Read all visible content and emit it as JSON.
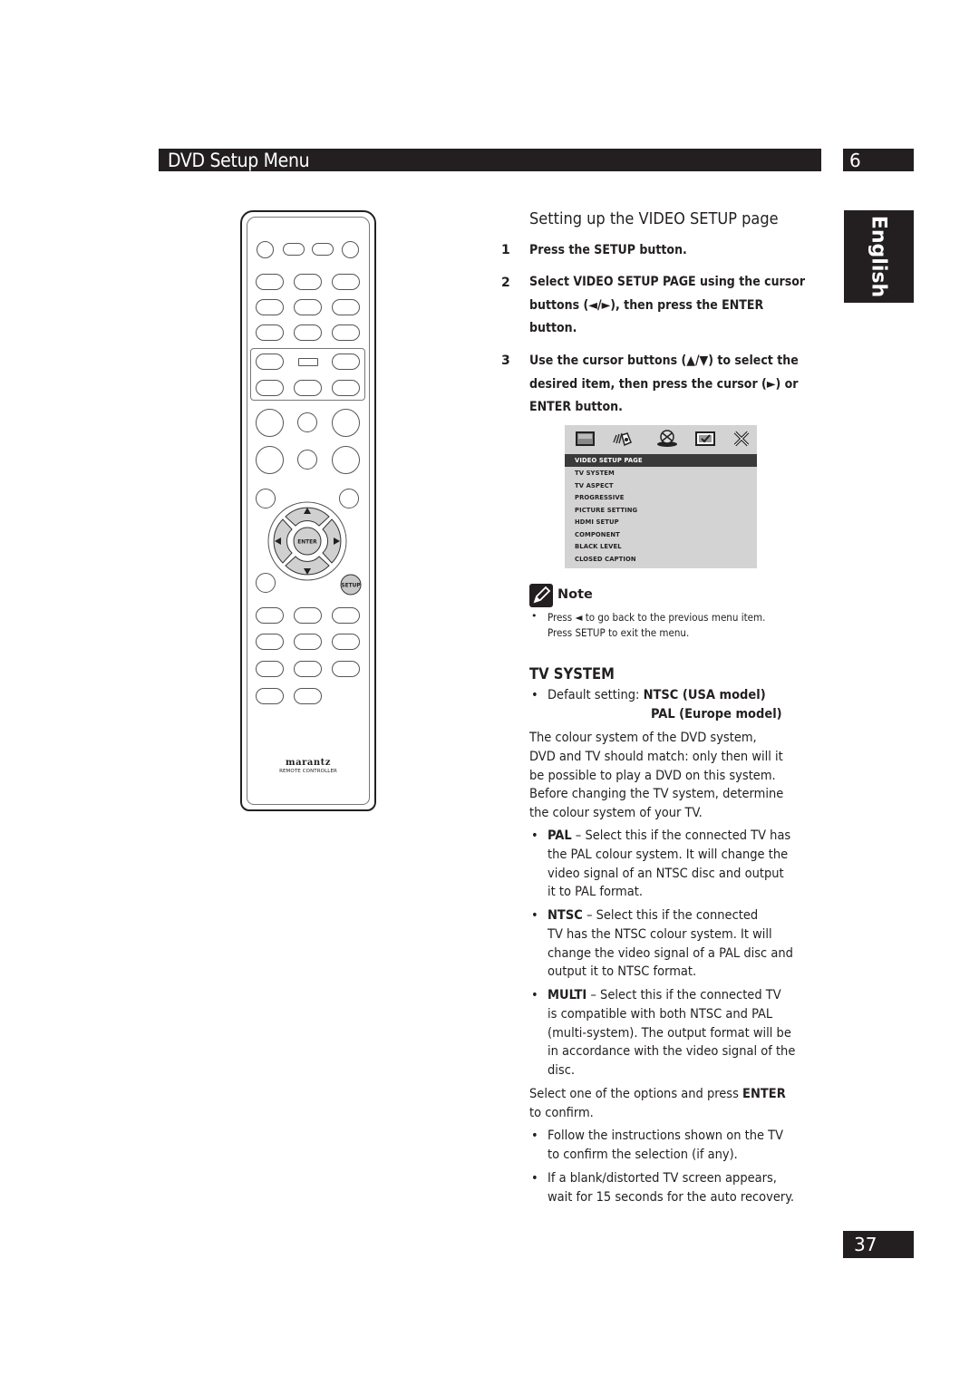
{
  "header": {
    "title": "DVD Setup Menu",
    "chapter": "6"
  },
  "language_tab": "English",
  "remote": {
    "brand": "marantz",
    "subtitle": "REMOTE CONTROLLER",
    "enter_label": "ENTER",
    "setup_label": "SETUP",
    "arrows": {
      "up": "▲",
      "down": "▼",
      "left": "◄",
      "right": "►"
    }
  },
  "section": {
    "title": "Setting up the VIDEO SETUP page",
    "steps": [
      {
        "num": "1",
        "lines": [
          "Press the SETUP button."
        ]
      },
      {
        "num": "2",
        "lines": [
          "Select VIDEO SETUP PAGE using the cursor",
          "buttons (◄/►), then press the ENTER",
          "button."
        ]
      },
      {
        "num": "3",
        "lines": [
          "Use the cursor buttons (▲/▼) to select the",
          "desired item, then press the cursor (►) or",
          "ENTER button."
        ]
      }
    ]
  },
  "osd_menu": {
    "icons": [
      "tv-screen-icon",
      "audio-speaker-icon",
      "disc-icon",
      "checkbox-icon",
      "close-x-icon"
    ],
    "selected_header": "VIDEO SETUP PAGE",
    "items": [
      "TV SYSTEM",
      "TV ASPECT",
      "PROGRESSIVE",
      "PICTURE SETTING",
      "HDMI SETUP",
      "COMPONENT",
      "BLACK LEVEL",
      "CLOSED CAPTION"
    ]
  },
  "note": {
    "label": "Note",
    "lines": [
      "Press ◄ to go back to the previous menu item.",
      "Press SETUP to exit the menu."
    ]
  },
  "tv_system": {
    "title": "TV SYSTEM",
    "default_label": "Default setting: ",
    "default_values": [
      "NTSC (USA model)",
      "PAL (Europe model)"
    ],
    "intro_lines": [
      "The colour system of the DVD system,",
      "DVD and TV should match: only then will it",
      "be possible to play a DVD on this system.",
      "Before changing the TV system, determine",
      "the colour system of your TV."
    ],
    "options": [
      {
        "name": "PAL",
        "lines": [
          " – Select this if the connected TV has",
          "the PAL colour system. It will change the",
          "video signal of an NTSC disc and output",
          "it to PAL format."
        ]
      },
      {
        "name": "NTSC",
        "lines": [
          " – Select this if the connected",
          "TV has the NTSC colour system. It will",
          "change the video signal of a PAL disc and",
          "output it to NTSC format."
        ]
      },
      {
        "name": "MULTI",
        "lines": [
          " – Select this if the connected TV",
          "is compatible with both NTSC and PAL",
          "(multi-system). The output format will be",
          "in accordance with the video signal of the",
          "disc."
        ]
      }
    ],
    "confirm_prefix": "Select one of the options and press ",
    "confirm_bold": "ENTER",
    "confirm_suffix": "to confirm.",
    "tips": [
      [
        "Follow the instructions shown on the TV",
        "to confirm the selection (if any)."
      ],
      [
        "If a blank/distorted TV screen appears,",
        "wait for 15 seconds for the auto recovery."
      ]
    ]
  },
  "page_number": "37"
}
